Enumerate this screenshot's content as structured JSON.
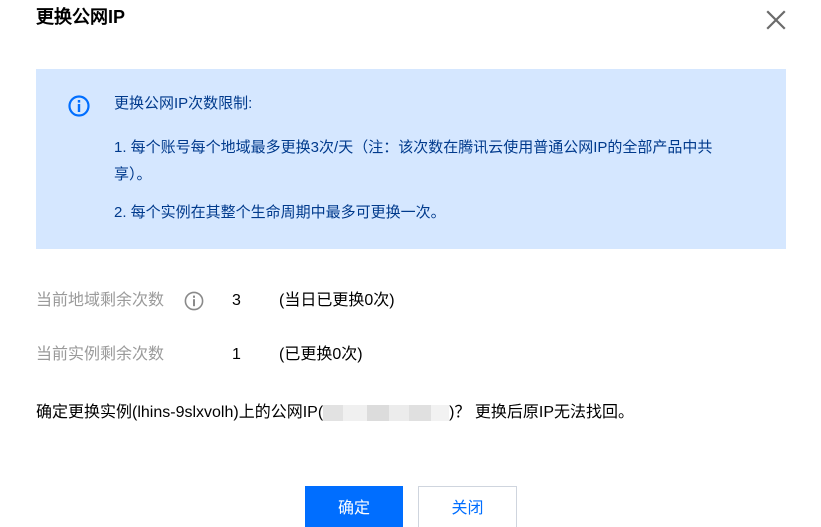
{
  "dialog": {
    "title": "更换公网IP",
    "close_icon": "close-icon"
  },
  "notice": {
    "icon": "info-icon",
    "title": "更换公网IP次数限制:",
    "item1": "1. 每个账号每个地域最多更换3次/天（注：该次数在腾讯云使用普通公网IP的全部产品中共享）。",
    "item2": "2. 每个实例在其整个生命周期中最多可更换一次。",
    "bg_color": "#d5e7ff",
    "text_color": "#003a8c"
  },
  "region_remaining": {
    "label": "当前地域剩余次数",
    "help_icon": "question-circle-icon",
    "value": "3",
    "note": "(当日已更换0次)"
  },
  "instance_remaining": {
    "label": "当前实例剩余次数",
    "value": "1",
    "note": "(已更换0次)"
  },
  "confirm": {
    "prefix": "确定更换实例(lhins-9slxvolh)上的公网IP(",
    "suffix": ")？ 更换后原IP无法找回。"
  },
  "buttons": {
    "confirm_label": "确定",
    "close_label": "关闭",
    "primary_color": "#006eff"
  }
}
